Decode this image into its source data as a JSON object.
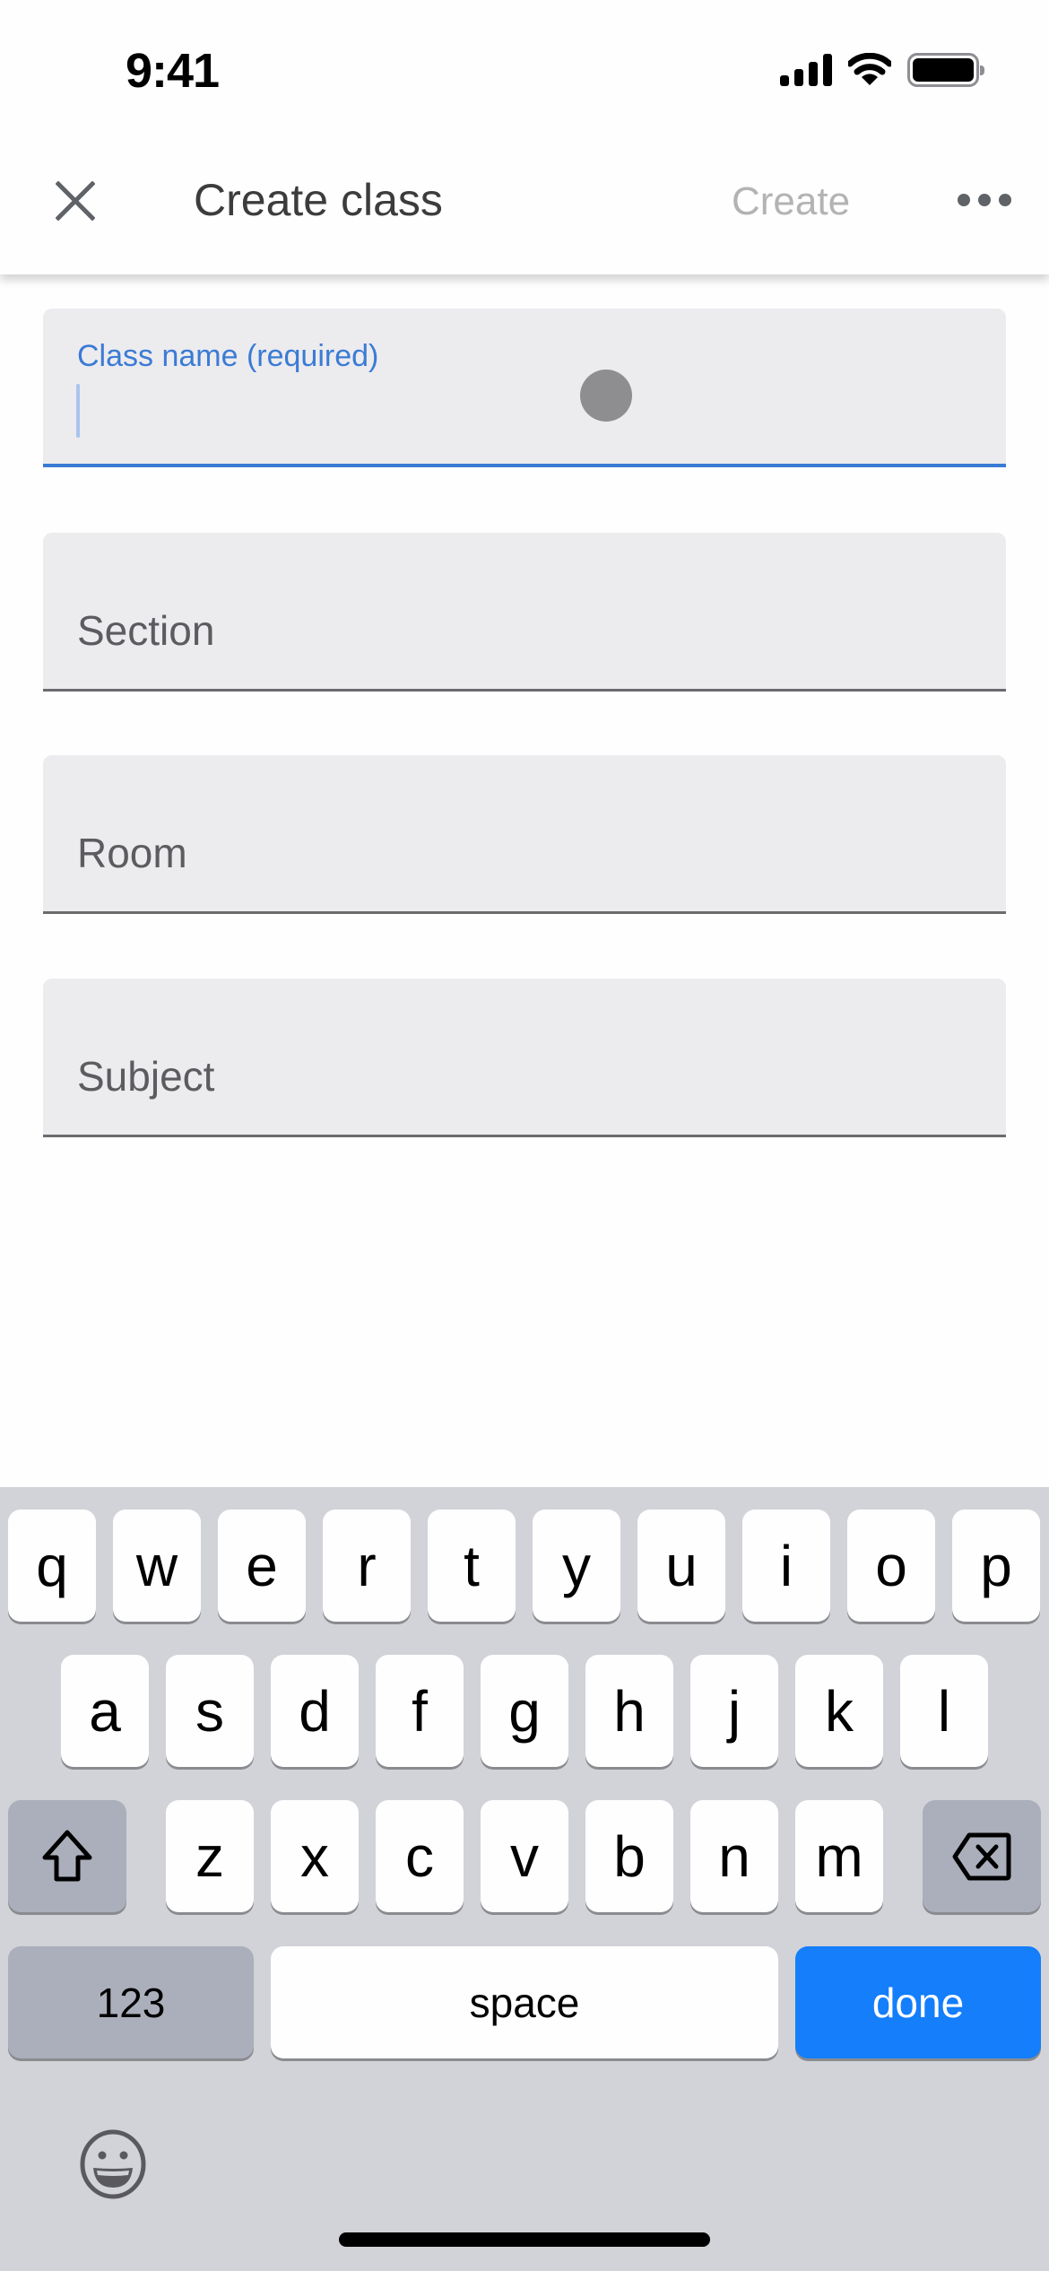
{
  "status_bar": {
    "time": "9:41",
    "icons": [
      "cellular-signal-icon",
      "wifi-icon",
      "battery-icon"
    ]
  },
  "app_bar": {
    "close_icon": "close-icon",
    "title": "Create class",
    "create_label": "Create",
    "more_icon": "more-horizontal-icon",
    "create_enabled": false
  },
  "form": {
    "fields": [
      {
        "label": "Class name (required)",
        "value": "",
        "focused": true
      },
      {
        "label": "Section",
        "value": "",
        "focused": false
      },
      {
        "label": "Room",
        "value": "",
        "focused": false
      },
      {
        "label": "Subject",
        "value": "",
        "focused": false
      }
    ]
  },
  "keyboard": {
    "row1": [
      "q",
      "w",
      "e",
      "r",
      "t",
      "y",
      "u",
      "i",
      "o",
      "p"
    ],
    "row2": [
      "a",
      "s",
      "d",
      "f",
      "g",
      "h",
      "j",
      "k",
      "l"
    ],
    "row3": [
      "z",
      "x",
      "c",
      "v",
      "b",
      "n",
      "m"
    ],
    "shift_icon": "shift-icon",
    "delete_icon": "delete-backspace-icon",
    "numbers_label": "123",
    "space_label": "space",
    "done_label": "done",
    "emoji_icon": "emoji-icon",
    "accent_color": "#147efb"
  },
  "colors": {
    "focus_blue": "#3a7bd5",
    "field_bg": "#ecebee"
  }
}
